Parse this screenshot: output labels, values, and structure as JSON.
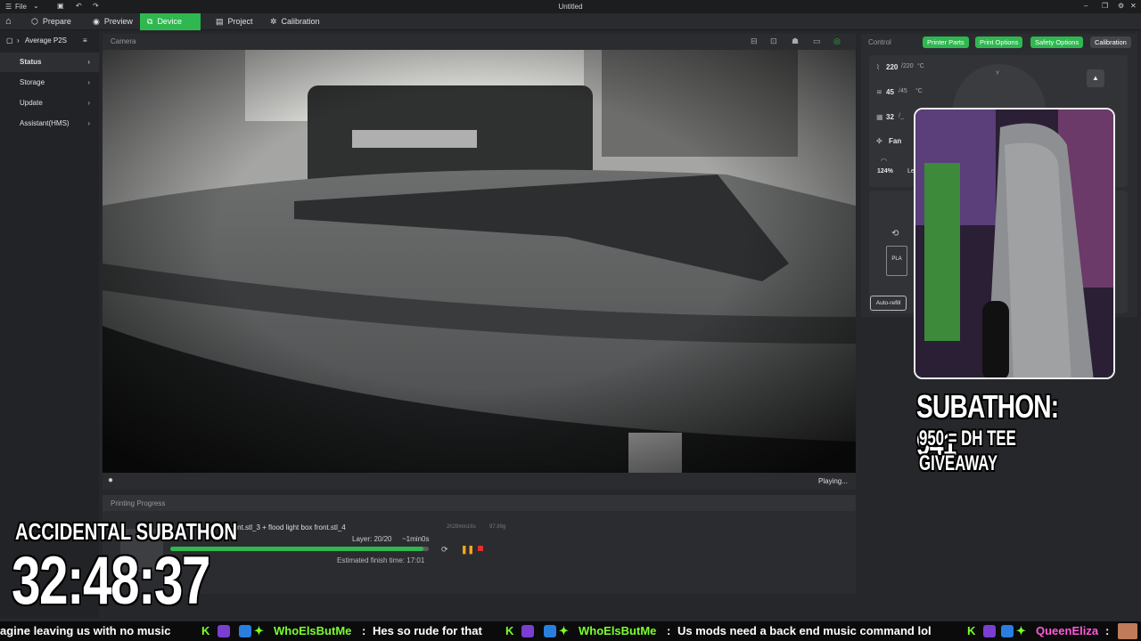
{
  "titlebar": {
    "file_label": "File",
    "title": "Untitled"
  },
  "nav": {
    "tabs": [
      {
        "label": "Prepare",
        "icon": "cube-icon"
      },
      {
        "label": "Preview",
        "icon": "eye-icon"
      },
      {
        "label": "Device",
        "icon": "device-icon",
        "active": true
      },
      {
        "label": "Project",
        "icon": "project-icon"
      },
      {
        "label": "Calibration",
        "icon": "calibration-icon"
      }
    ]
  },
  "sidebar": {
    "printer_name": "Average P2S",
    "items": [
      {
        "label": "Status",
        "active": true
      },
      {
        "label": "Storage"
      },
      {
        "label": "Update"
      },
      {
        "label": "Assistant(HMS)"
      }
    ]
  },
  "camera": {
    "label": "Camera",
    "status": "Playing..."
  },
  "progress": {
    "title": "Printing Progress",
    "file": "ront.stl_3 + flood light box front.stl_4",
    "time_used": "2h28min16s",
    "weight": "97.89g",
    "layer": "Layer: 20/20",
    "remaining": "~1min0s",
    "estimated": "Estimated finish time: 17:01",
    "progress_fraction": 0.98
  },
  "control": {
    "title": "Control",
    "buttons": [
      "Printer Parts",
      "Print Options",
      "Safety Options",
      "Calibration"
    ],
    "nozzle_temp": "220",
    "nozzle_target": "/220",
    "temp_unit": "°C",
    "bed_temp": "45",
    "bed_target": "/45",
    "chamber_temp": "32",
    "chamber_target": "/_",
    "fan_label": "Fan",
    "speed": "124%",
    "speed_label": "Le",
    "filament": "PLA",
    "auto_refill": "Auto-refill",
    "jog_y": "Y"
  },
  "overlay": {
    "subathon_count": "SUBATHON: 941",
    "giveaway": "950 = DH TEE GIVEAWAY",
    "timer_title": "ACCIDENTAL SUBATHON",
    "timer": "32:48:37"
  },
  "chat": {
    "message_1": "agine leaving us with no music",
    "user_1": "WhoElsButMe",
    "message_2": "Hes so rude for that",
    "user_2": "WhoElsButMe",
    "message_3": "Us mods need a back end music command lol",
    "user_3": "QueenEliza",
    "separator": ":"
  },
  "colors": {
    "accent": "#2eb84f",
    "stop": "#e0312b",
    "pause": "#f5a623",
    "username": "#7cff2e",
    "queen": "#ff5ad8"
  }
}
